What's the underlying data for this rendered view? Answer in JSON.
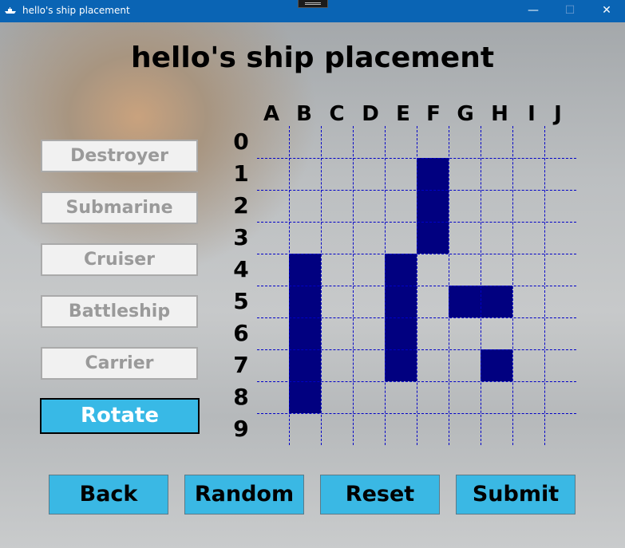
{
  "window": {
    "title": "hello's ship placement",
    "controls": [
      "—",
      "☐",
      "✕"
    ]
  },
  "heading": "hello's ship placement",
  "ships": [
    "Destroyer",
    "Submarine",
    "Cruiser",
    "Battleship",
    "Carrier"
  ],
  "rotate_label": "Rotate",
  "actions": [
    "Back",
    "Random",
    "Reset",
    "Submit"
  ],
  "grid": {
    "columns": [
      "A",
      "B",
      "C",
      "D",
      "E",
      "F",
      "G",
      "H",
      "I",
      "J"
    ],
    "rows": [
      "0",
      "1",
      "2",
      "3",
      "4",
      "5",
      "6",
      "7",
      "8",
      "9"
    ],
    "occupied": [
      {
        "col": "F",
        "row": 1
      },
      {
        "col": "F",
        "row": 2
      },
      {
        "col": "F",
        "row": 3
      },
      {
        "col": "B",
        "row": 4
      },
      {
        "col": "B",
        "row": 5
      },
      {
        "col": "B",
        "row": 6
      },
      {
        "col": "B",
        "row": 7
      },
      {
        "col": "B",
        "row": 8
      },
      {
        "col": "E",
        "row": 4
      },
      {
        "col": "E",
        "row": 5
      },
      {
        "col": "E",
        "row": 6
      },
      {
        "col": "E",
        "row": 7
      },
      {
        "col": "G",
        "row": 5
      },
      {
        "col": "H",
        "row": 5
      },
      {
        "col": "H",
        "row": 7
      }
    ]
  },
  "colors": {
    "titlebar": "#0a64b4",
    "ship_cell": "#010080",
    "action_button": "#3ab8e4",
    "rotate_button": "#38b9e6",
    "grid_line": "#0000c8"
  }
}
